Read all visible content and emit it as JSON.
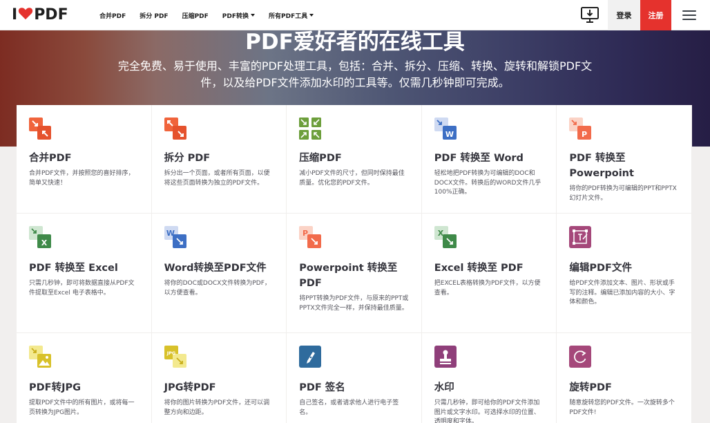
{
  "header": {
    "logo_pre": "I",
    "logo_post": "PDF",
    "nav": [
      {
        "label": "合并PDF",
        "dropdown": false
      },
      {
        "label": "拆分 PDF",
        "dropdown": false
      },
      {
        "label": "压缩PDF",
        "dropdown": false
      },
      {
        "label": "PDF转换",
        "dropdown": true
      },
      {
        "label": "所有PDF工具",
        "dropdown": true
      }
    ],
    "login": "登录",
    "register": "注册"
  },
  "hero": {
    "title": "PDF爱好者的在线工具",
    "subtitle_line1": "完全免费、易于使用、丰富的PDF处理工具，包括：合并、拆分、压缩、转换、旋转和解锁PDF文",
    "subtitle_line2": "件，以及给PDF文件添加水印的工具等。仅需几秒钟即可完成。"
  },
  "tools": [
    {
      "icon": "merge-icon",
      "title": "合并PDF",
      "desc": "合并PDF文件，并按照您的喜好排序，简单又快速！"
    },
    {
      "icon": "split-icon",
      "title": "拆分 PDF",
      "desc": "拆分出一个页面，或者所有页面，以便将这些页面转换为独立的PDF文件。"
    },
    {
      "icon": "compress-icon",
      "title": "压缩PDF",
      "desc": "减小PDF文件的尺寸，但同时保持最佳质量。优化您的PDF文件。"
    },
    {
      "icon": "pdf-to-word-icon",
      "title": "PDF 转换至 Word",
      "desc": "轻松地把PDF转换为可编辑的DOC和DOCX文件。转换后的WORD文件几乎100%正确。"
    },
    {
      "icon": "pdf-to-ppt-icon",
      "title": "PDF 转换至 Powerpoint",
      "desc": "将你的PDF转换为可编辑的PPT和PPTX幻灯片文件。"
    },
    {
      "icon": "pdf-to-excel-icon",
      "title": "PDF 转换至 Excel",
      "desc": "只需几秒钟，即可将数据直接从PDF文件提取至Excel 电子表格中。"
    },
    {
      "icon": "word-to-pdf-icon",
      "title": "Word转换至PDF文件",
      "desc": "将你的DOC或DOCX文件转换为PDF，以方便查看。"
    },
    {
      "icon": "ppt-to-pdf-icon",
      "title": "Powerpoint 转换至 PDF",
      "desc": "将PPT转换为PDF文件，与原来的PPT或PPTX文件完全一样，并保持最佳质量。"
    },
    {
      "icon": "excel-to-pdf-icon",
      "title": "Excel 转换至 PDF",
      "desc": "把EXCEL表格转换为PDF文件，以方便查看。"
    },
    {
      "icon": "edit-pdf-icon",
      "title": "编辑PDF文件",
      "desc": "给PDF文件添加文本、图片、形状或手写的注释。编辑已添加内容的大小、字体和颜色。"
    },
    {
      "icon": "pdf-to-jpg-icon",
      "title": "PDF转JPG",
      "desc": "提取PDF文件中的所有图片，或将每一页转换为JPG图片。"
    },
    {
      "icon": "jpg-to-pdf-icon",
      "title": "JPG转PDF",
      "desc": "将你的图片转换为PDF文件，还可以调整方向和边距。"
    },
    {
      "icon": "sign-pdf-icon",
      "title": "PDF 签名",
      "desc": "自己签名，或者请求他人进行电子签名。"
    },
    {
      "icon": "watermark-icon",
      "title": "水印",
      "desc": "只需几秒钟，即可给你的PDF文件添加图片或文字水印。可选择水印的位置、透明度和字体。"
    },
    {
      "icon": "rotate-pdf-icon",
      "title": "旋转PDF",
      "desc": "随意旋转您的PDF文件。一次旋转多个PDF文件!"
    }
  ],
  "colors": {
    "accent": "#e5322d",
    "merge": "#e5522d",
    "compress": "#6d9f3c",
    "word": "#3d6fc4",
    "ppt": "#f26b4b",
    "excel": "#3f8a49",
    "edit": "#a5487a",
    "jpg": "#d8c12a",
    "sign": "#2f6b9d",
    "watermark": "#8f3f7a"
  }
}
